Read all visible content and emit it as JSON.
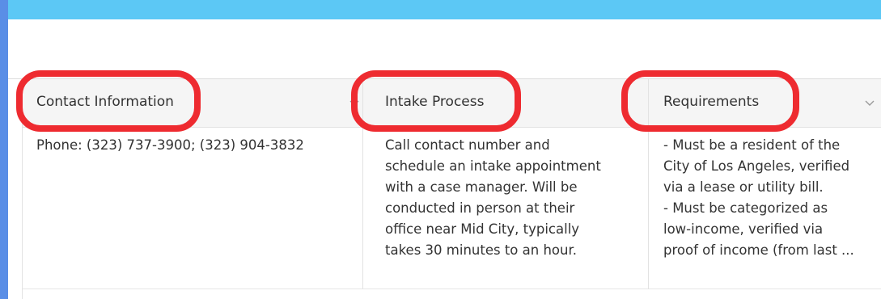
{
  "table": {
    "columns": [
      {
        "label": "Contact Information"
      },
      {
        "label": "Intake Process"
      },
      {
        "label": "Requirements"
      }
    ],
    "rows": [
      {
        "contact": "Phone: (323) 737-3900; (323) 904-3832",
        "intake_lines": [
          "Call contact number and",
          "schedule an intake appointment",
          "with a case manager. Will be",
          "conducted in person at their",
          "office near Mid City, typically",
          "takes 30 minutes to an hour."
        ],
        "requirements_lines": [
          "- Must be a resident of the",
          "City of Los Angeles, verified",
          "via a lease or utility bill.",
          "- Must be categorized as",
          "low-income, verified via",
          "proof of income (from last ..."
        ]
      }
    ]
  },
  "icons": {
    "column_menu": "chevron-down-icon"
  },
  "colors": {
    "top_bar": "#5cc8f5",
    "frame_border": "#5a8ee6",
    "highlight": "#ee2b30",
    "header_bg": "#f5f5f5"
  }
}
